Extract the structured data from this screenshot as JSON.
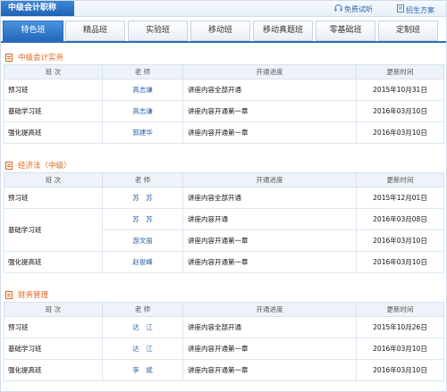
{
  "header": {
    "title": "中级会计职称",
    "links": [
      {
        "label": "免费试听",
        "icon": "headphones-icon"
      },
      {
        "label": "招生方案",
        "icon": "document-icon"
      }
    ]
  },
  "tabs": [
    "特色班",
    "精品班",
    "实验班",
    "移动班",
    "移动真题班",
    "零基础班",
    "定制班"
  ],
  "active_tab": "特色班",
  "table_headers": [
    "班 次",
    "老 师",
    "开通进度",
    "更新时间"
  ],
  "sections": [
    {
      "title": "中级会计实务",
      "rows": [
        {
          "cls": "预习班",
          "teacher": "高志谦",
          "progress": "讲座内容全部开通",
          "time": "2015年10月31日"
        },
        {
          "cls": "基础学习班",
          "teacher": "高志谦",
          "progress": "讲座内容开通第一章",
          "time": "2016年03月10日"
        },
        {
          "cls": "强化提高班",
          "teacher": "郭建华",
          "progress": "讲座内容开通第一章",
          "time": "2016年03月10日"
        }
      ]
    },
    {
      "title": "经济法（中级）",
      "rows": [
        {
          "cls": "预习班",
          "teacher": "苏　苏",
          "progress": "讲座内容全部开通",
          "time": "2015年12月01日"
        },
        {
          "cls": "基础学习班",
          "teacher": "苏　苏",
          "progress": "讲座内容开通",
          "time": "2016年03月08日"
        },
        {
          "cls": "",
          "teacher": "游文丽",
          "progress": "讲座内容开通第一章",
          "time": "2016年03月10日"
        },
        {
          "cls": "强化提高班",
          "teacher": "赵俊峰",
          "progress": "讲座内容开通第一章",
          "time": "2016年03月10日"
        }
      ]
    },
    {
      "title": "财务管理",
      "rows": [
        {
          "cls": "预习班",
          "teacher": "达　江",
          "progress": "讲座内容全部开通",
          "time": "2015年10月26日"
        },
        {
          "cls": "基础学习班",
          "teacher": "达　江",
          "progress": "讲座内容开通第一章",
          "time": "2016年03月10日"
        },
        {
          "cls": "强化提高班",
          "teacher": "李　斌",
          "progress": "讲座内容开通第一章",
          "time": "2016年03月10日"
        }
      ]
    }
  ]
}
